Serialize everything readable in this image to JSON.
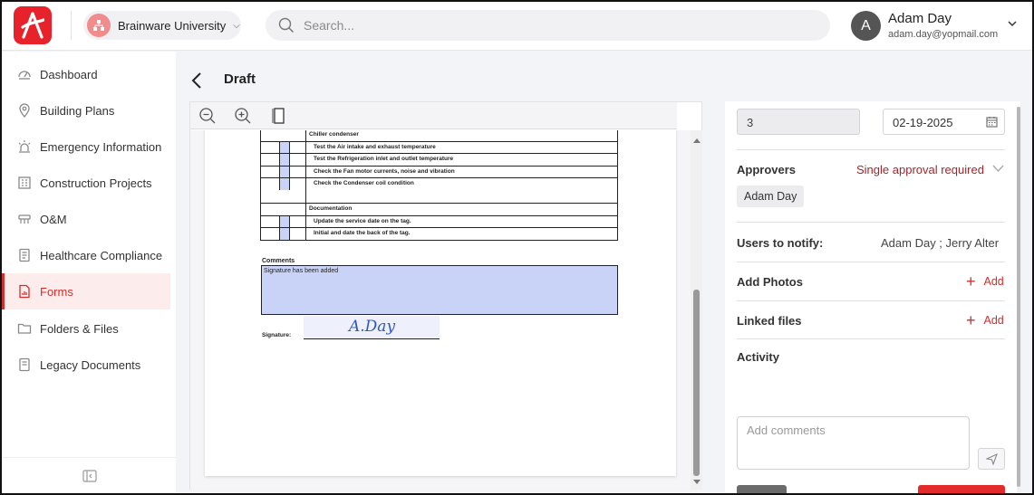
{
  "topbar": {
    "org_name": "Brainware University",
    "search_placeholder": "Search...",
    "user_initial": "A",
    "user_name": "Adam Day",
    "user_email": "adam.day@yopmail.com"
  },
  "sidebar": {
    "items": [
      {
        "label": "Dashboard",
        "icon": "dashboard-icon"
      },
      {
        "label": "Building Plans",
        "icon": "location-pin-icon"
      },
      {
        "label": "Emergency Information",
        "icon": "alarm-light-icon"
      },
      {
        "label": "Construction Projects",
        "icon": "building-icon"
      },
      {
        "label": "O&M",
        "icon": "tools-icon"
      },
      {
        "label": "Healthcare Compliance",
        "icon": "document-list-icon"
      },
      {
        "label": "Forms",
        "icon": "form-chart-icon",
        "active": true
      },
      {
        "label": "Folders & Files",
        "icon": "folder-icon"
      },
      {
        "label": "Legacy Documents",
        "icon": "document-icon"
      }
    ]
  },
  "page": {
    "title": "Draft"
  },
  "document": {
    "rows": [
      {
        "text": "Chiller condenser",
        "type": "header"
      },
      {
        "text": "Test the Air intake and exhaust temperature",
        "type": "check"
      },
      {
        "text": "Test the Refrigeration inlet and outlet temperature",
        "type": "check"
      },
      {
        "text": "Check the Fan motor currents, noise and vibration",
        "type": "check"
      },
      {
        "text": "Check the Condenser coil condition",
        "type": "check-tall"
      },
      {
        "text": "Documentation",
        "type": "header"
      },
      {
        "text": "Update the service date on the tag.",
        "type": "check"
      },
      {
        "text": "Initial and date the back of the tag.",
        "type": "check"
      }
    ],
    "comments_label": "Comments",
    "comments_text": "Signature has been added",
    "signature_label": "Signature:",
    "signature_value": "A.Day"
  },
  "details": {
    "number_value": "3",
    "date_value": "02-19-2025",
    "approvers_label": "Approvers",
    "approval_mode": "Single approval required",
    "approver_chip": "Adam Day",
    "notify_label": "Users to notify:",
    "notify_users": "Adam Day ;   Jerry Alter",
    "add_photos_label": "Add Photos",
    "linked_files_label": "Linked files",
    "add_label": "Add",
    "activity_label": "Activity",
    "comment_placeholder": "Add comments"
  },
  "colors": {
    "brand_red": "#e8222b",
    "accent_red": "#d42d2d",
    "field_highlight": "#c9d3f7"
  }
}
